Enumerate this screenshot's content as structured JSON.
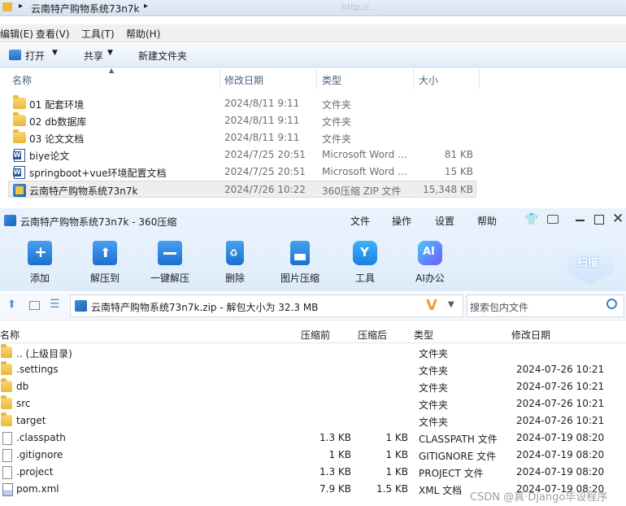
{
  "explorer": {
    "breadcrumb": "云南特产购物系统73n7k",
    "search_placeholder": "http://...",
    "menu": [
      "编辑(E)",
      "查看(V)",
      "工具(T)",
      "帮助(H)"
    ],
    "toolbar": {
      "open": "打开",
      "share": "共享",
      "new_folder": "新建文件夹"
    },
    "columns": {
      "name": "名称",
      "date": "修改日期",
      "type": "类型",
      "size": "大小"
    },
    "rows": [
      {
        "name": "01 配套环境",
        "date": "2024/8/11 9:11",
        "type": "文件夹",
        "size": "",
        "icon": "folder-icon"
      },
      {
        "name": "02 db数据库",
        "date": "2024/8/11 9:11",
        "type": "文件夹",
        "size": "",
        "icon": "folder-icon"
      },
      {
        "name": "03 论文文档",
        "date": "2024/8/11 9:11",
        "type": "文件夹",
        "size": "",
        "icon": "folder-icon"
      },
      {
        "name": "biye论文",
        "date": "2024/7/25 20:51",
        "type": "Microsoft Word ...",
        "size": "81 KB",
        "icon": "word-doc-icon"
      },
      {
        "name": "springboot+vue环境配置文档",
        "date": "2024/7/25 20:51",
        "type": "Microsoft Word ...",
        "size": "15 KB",
        "icon": "word-doc-icon"
      },
      {
        "name": "云南特产购物系统73n7k",
        "date": "2024/7/26 10:22",
        "type": "360压缩 ZIP 文件",
        "size": "15,348 KB",
        "icon": "zip-archive-icon"
      }
    ]
  },
  "zip": {
    "title": "云南特产购物系统73n7k - 360压缩",
    "menus": [
      "文件",
      "操作",
      "设置",
      "帮助"
    ],
    "toolbar": [
      {
        "label": "添加",
        "icon": "add-icon"
      },
      {
        "label": "解压到",
        "icon": "extract-to-icon"
      },
      {
        "label": "一键解压",
        "icon": "one-click-extract-icon"
      },
      {
        "label": "删除",
        "icon": "delete-icon"
      },
      {
        "label": "图片压缩",
        "icon": "image-compress-icon"
      },
      {
        "label": "工具",
        "icon": "tools-icon"
      },
      {
        "label": "AI办公",
        "icon": "ai-office-icon"
      }
    ],
    "scan_label": "扫描",
    "ai_badge": "AI",
    "path": "云南特产购物系统73n7k.zip - 解包大小为 32.3 MB",
    "search_placeholder": "搜索包内文件",
    "columns": {
      "name": "名称",
      "compressed_before": "压缩前",
      "compressed_after": "压缩后",
      "type": "类型",
      "date": "修改日期"
    },
    "rows": [
      {
        "name": ".. (上级目录)",
        "before": "",
        "after": "",
        "type": "文件夹",
        "date": "",
        "icon": "folder-icon"
      },
      {
        "name": ".settings",
        "before": "",
        "after": "",
        "type": "文件夹",
        "date": "2024-07-26 10:21",
        "icon": "folder-icon"
      },
      {
        "name": "db",
        "before": "",
        "after": "",
        "type": "文件夹",
        "date": "2024-07-26 10:21",
        "icon": "folder-icon"
      },
      {
        "name": "src",
        "before": "",
        "after": "",
        "type": "文件夹",
        "date": "2024-07-26 10:21",
        "icon": "folder-icon"
      },
      {
        "name": "target",
        "before": "",
        "after": "",
        "type": "文件夹",
        "date": "2024-07-26 10:21",
        "icon": "folder-icon"
      },
      {
        "name": ".classpath",
        "before": "1.3 KB",
        "after": "1 KB",
        "type": "CLASSPATH 文件",
        "date": "2024-07-19 08:20",
        "icon": "file-icon"
      },
      {
        "name": ".gitignore",
        "before": "1 KB",
        "after": "1 KB",
        "type": "GITIGNORE 文件",
        "date": "2024-07-19 08:20",
        "icon": "file-icon"
      },
      {
        "name": ".project",
        "before": "1.3 KB",
        "after": "1 KB",
        "type": "PROJECT 文件",
        "date": "2024-07-19 08:20",
        "icon": "file-icon"
      },
      {
        "name": "pom.xml",
        "before": "7.9 KB",
        "after": "1.5 KB",
        "type": "XML 文档",
        "date": "2024-07-19 08:20",
        "icon": "xml-file-icon"
      }
    ]
  },
  "watermark": "CSDN @真·Django毕设程序",
  "colors": {
    "accent": "#1a7fe0",
    "titlebar": "#e8f2fc",
    "selection": "#eeeeee"
  }
}
